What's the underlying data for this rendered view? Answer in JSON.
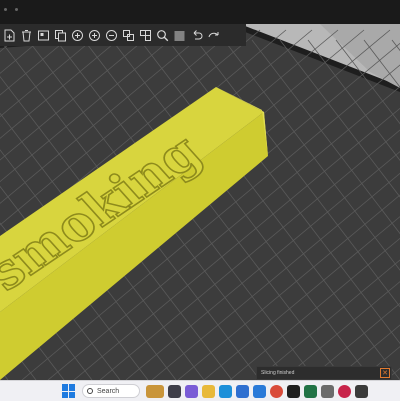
{
  "viewport": {
    "model_text": "smoking",
    "model_color": "#d8d53e",
    "bed_color": "#3c3c3c",
    "grid_line_color": "#5a5a5a",
    "background_color": "#1e1e1e",
    "wall_color": "#b8b8b8"
  },
  "toolbar": {
    "icons": [
      "add-file-icon",
      "delete-icon",
      "arrange-icon",
      "copy-icon",
      "paste-icon",
      "add-instance-icon",
      "remove-instance-icon",
      "split-objects-icon",
      "split-parts-icon",
      "search-icon",
      "layers-icon",
      "undo-icon",
      "redo-icon"
    ]
  },
  "notification": {
    "message": "Slicing finished",
    "accent_color": "#e07a30"
  },
  "taskbar": {
    "search_placeholder": "Search",
    "start_icon": "windows-start-icon",
    "accent_color": "#1f7be0"
  }
}
